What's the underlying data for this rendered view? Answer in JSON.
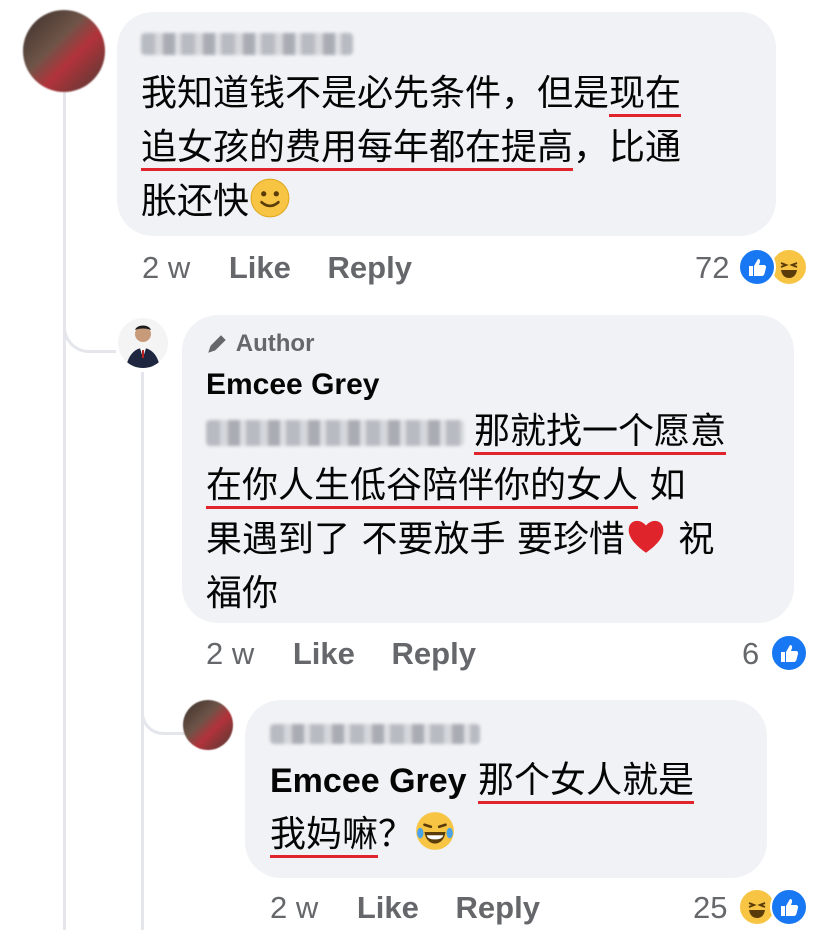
{
  "comments": [
    {
      "text_lines": [
        [
          "我知道钱不是必先条件，但是",
          "现在"
        ],
        [
          "追女孩的费用每年都在提高",
          "，比通"
        ],
        [
          "胀还快"
        ]
      ],
      "meta": {
        "time": "2 w",
        "like": "Like",
        "reply": "Reply"
      },
      "reaction_count": "72",
      "reactions": [
        "like-icon",
        "haha-icon"
      ],
      "emoji": "slightly-smiling-face-icon"
    },
    {
      "author_badge": "Author",
      "author_name": "Emcee Grey",
      "text_lines": [
        [
          "那就找一个愿意"
        ],
        [
          "在你人生低谷陪伴你的女人",
          " 如"
        ],
        [
          "果遇到了 不要放手 要珍惜",
          " 祝"
        ],
        [
          "福你"
        ]
      ],
      "meta": {
        "time": "2 w",
        "like": "Like",
        "reply": "Reply"
      },
      "reaction_count": "6",
      "reactions": [
        "like-icon"
      ],
      "emoji": "red-heart-icon"
    },
    {
      "mention": "Emcee Grey",
      "text_lines": [
        [
          "那个女人就是"
        ],
        [
          "我妈嘛",
          "？"
        ]
      ],
      "meta": {
        "time": "2 w",
        "like": "Like",
        "reply": "Reply"
      },
      "reaction_count": "25",
      "reactions": [
        "haha-icon",
        "like-icon"
      ],
      "emoji": "tears-of-joy-icon"
    }
  ],
  "colors": {
    "underline": "#e0242c",
    "bubble": "#f0f2f5",
    "meta": "#65676b",
    "like": "#1877f2",
    "haha": "#f7c543"
  }
}
